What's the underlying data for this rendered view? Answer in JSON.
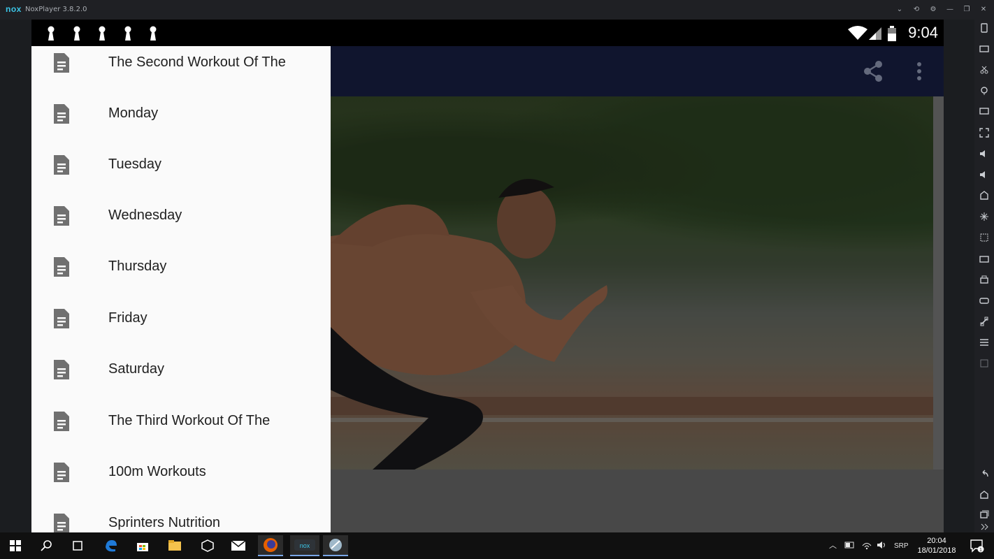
{
  "window": {
    "logo_text": "nox",
    "title": "NoxPlayer 3.8.2.0",
    "controls": [
      "chevron-down-icon",
      "pin-icon",
      "gear-icon",
      "minimize-icon",
      "restore-icon",
      "close-icon"
    ]
  },
  "statusbar": {
    "time": "9:04",
    "notification_icons": [
      "chess-pawn-icon",
      "chess-pawn-icon",
      "chess-pawn-icon",
      "chess-pawn-icon",
      "chess-pawn-icon"
    ],
    "system_icons": [
      "wifi-icon",
      "signal-icon",
      "battery-icon"
    ]
  },
  "appbar": {
    "actions": [
      "share-icon",
      "more-vert-icon"
    ]
  },
  "drawer": {
    "items": [
      {
        "label": "The Second Workout Of The",
        "icon": "document-icon"
      },
      {
        "label": "Monday",
        "icon": "document-icon"
      },
      {
        "label": "Tuesday",
        "icon": "document-icon"
      },
      {
        "label": "Wednesday",
        "icon": "document-icon"
      },
      {
        "label": "Thursday",
        "icon": "document-icon"
      },
      {
        "label": "Friday",
        "icon": "document-icon"
      },
      {
        "label": "Saturday",
        "icon": "document-icon"
      },
      {
        "label": "The Third Workout Of The",
        "icon": "document-icon"
      },
      {
        "label": "100m Workouts",
        "icon": "document-icon"
      },
      {
        "label": "Sprinters Nutrition",
        "icon": "document-icon"
      }
    ]
  },
  "hero": {
    "subject": "sprinter-starting-run-photo"
  },
  "taskbar": {
    "apps": [
      "windows-start-icon",
      "search-icon",
      "task-view-icon",
      "edge-icon",
      "store-icon",
      "file-explorer-icon",
      "unity-icon",
      "mail-icon",
      "firefox-icon",
      "nox-icon",
      "app-icon"
    ],
    "language": "SRP",
    "time": "20:04",
    "date": "18/01/2018",
    "notification_count": "1"
  },
  "colors": {
    "appbar": "#1a2147",
    "drawer_bg": "#fafafa",
    "drawer_text": "#212121",
    "doc_icon": "#707070"
  }
}
